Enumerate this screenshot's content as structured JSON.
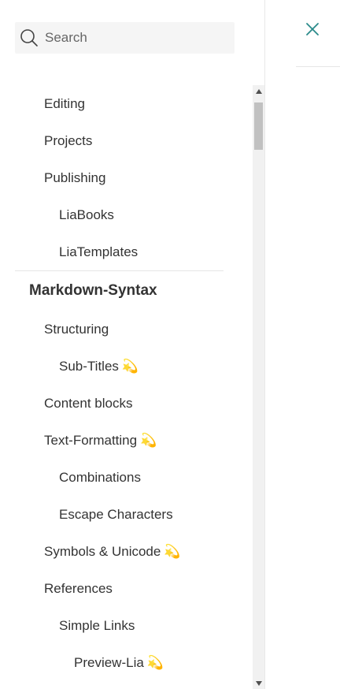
{
  "search": {
    "placeholder": "Search"
  },
  "nav": {
    "editing": "Editing",
    "projects": "Projects",
    "publishing": "Publishing",
    "liabooks": "LiaBooks",
    "liatemplates": "LiaTemplates",
    "markdown_syntax": "Markdown-Syntax",
    "structuring": "Structuring",
    "sub_titles": "Sub-Titles",
    "content_blocks": "Content blocks",
    "text_formatting": "Text-Formatting",
    "combinations": "Combinations",
    "escape_characters": "Escape Characters",
    "symbols_unicode": "Symbols & Unicode",
    "references": "References",
    "simple_links": "Simple Links",
    "preview_lia": "Preview-Lia"
  },
  "icons": {
    "search": "search-icon",
    "close": "close-icon",
    "sparkle": "💫"
  },
  "colors": {
    "accent": "#2a8a8a"
  }
}
